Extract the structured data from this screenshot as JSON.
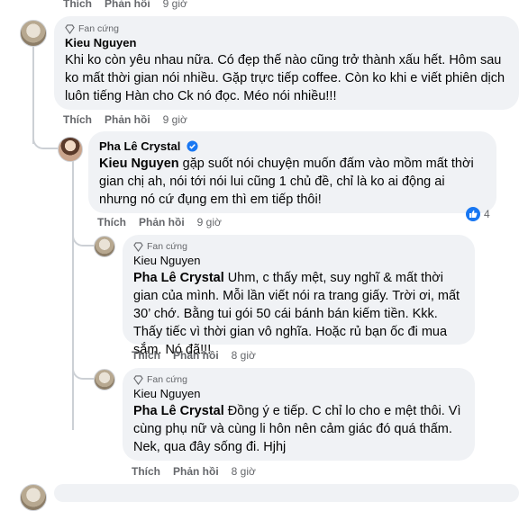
{
  "actions": {
    "like": "Thích",
    "reply": "Phản hồi"
  },
  "top_action_row": {
    "time": "9 giờ"
  },
  "comments": [
    {
      "badge": "Fan cứng",
      "author": "Kieu Nguyen",
      "text": "Khi ko còn yêu nhau nữa. Có đẹp thế nào cũng trở thành xấu hết. Hôm sau ko mất thời gian nói nhiều. Gặp trực tiếp coffee. Còn ko khi e viết phiên dịch luôn tiếng Hàn cho Ck nó đọc. Méo nói nhiều!!!",
      "time": "9 giờ"
    },
    {
      "author": "Pha Lê Crystal",
      "verified": true,
      "mention": "Kieu Nguyen",
      "text": " gặp suốt nói chuyện muốn đấm vào mồm mất thời gian chị ah, nói tới nói lui cũng 1 chủ đề, chỉ là ko ai động ai nhưng nó cứ đụng em thì em tiếp thôi!",
      "time": "9 giờ",
      "reaction_count": "4"
    },
    {
      "badge": "Fan cứng",
      "author": "Kieu Nguyen",
      "mention": "Pha Lê Crystal",
      "text": " Uhm, c thấy mệt, suy nghĩ & mất thời gian của mình. Mỗi lần viết nói ra trang giấy. Trời ơi, mất 30’ chớ. Bằng tui gói 50 cái bánh bán kiếm tiền. Kkk. Thấy tiếc vì thời gian vô nghĩa. Hoặc rủ bạn ốc đi mua sắm. Nó đã!!!",
      "time": "8 giờ"
    },
    {
      "badge": "Fan cứng",
      "author": "Kieu Nguyen",
      "mention": "Pha Lê Crystal",
      "text": " Đồng ý e tiếp. C chỉ lo cho e mệt thôi. Vì cùng phụ nữ và cùng li hôn nên cảm giác đó quá thấm. Nek, qua đây sống đi. Hjhj",
      "time": "8 giờ"
    }
  ],
  "colors": {
    "bubble": "#f0f2f5",
    "verified": "#1877f2",
    "meta": "#65676b",
    "line": "#ccd0d5"
  }
}
